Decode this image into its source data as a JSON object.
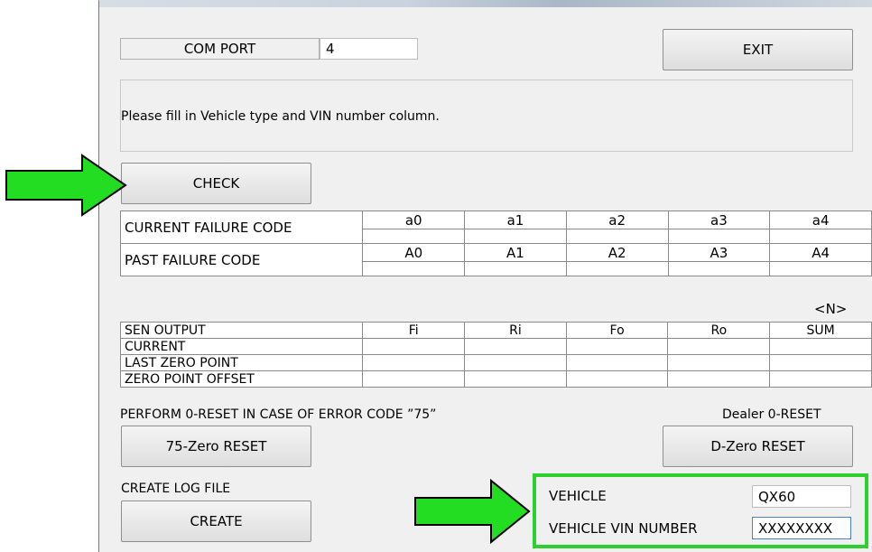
{
  "com_port": {
    "label": "COM PORT",
    "value": "4"
  },
  "exit_button": "EXIT",
  "message": "Please fill in Vehicle type and VIN number column.",
  "check_button": "CHECK",
  "failure_table": {
    "current_label": "CURRENT FAILURE CODE",
    "past_label": "PAST FAILURE CODE",
    "current_headers": [
      "a0",
      "a1",
      "a2",
      "a3",
      "a4"
    ],
    "past_headers": [
      "A0",
      "A1",
      "A2",
      "A3",
      "A4"
    ]
  },
  "unit_label": "<N>",
  "sensor_table": {
    "header_label": "SEN OUTPUT",
    "columns": [
      "Fi",
      "Ri",
      "Fo",
      "Ro",
      "SUM"
    ],
    "rows": [
      "CURRENT",
      "LAST ZERO POINT",
      "ZERO POINT OFFSET"
    ]
  },
  "zero_reset": {
    "instruction": "PERFORM 0-RESET IN CASE OF ERROR CODE ”75”",
    "button": "75-Zero RESET"
  },
  "dealer_reset": {
    "label": "Dealer 0-RESET",
    "button": "D-Zero RESET"
  },
  "log_file": {
    "label": "CREATE LOG FILE",
    "button": "CREATE"
  },
  "vehicle": {
    "label": "VEHICLE",
    "value": "QX60",
    "vin_label": "VEHICLE VIN NUMBER",
    "vin_value": "XXXXXXXX"
  },
  "colors": {
    "highlight": "#2dd12d",
    "arrow_fill": "#22dd22",
    "window_bg": "#f0f0f0"
  }
}
